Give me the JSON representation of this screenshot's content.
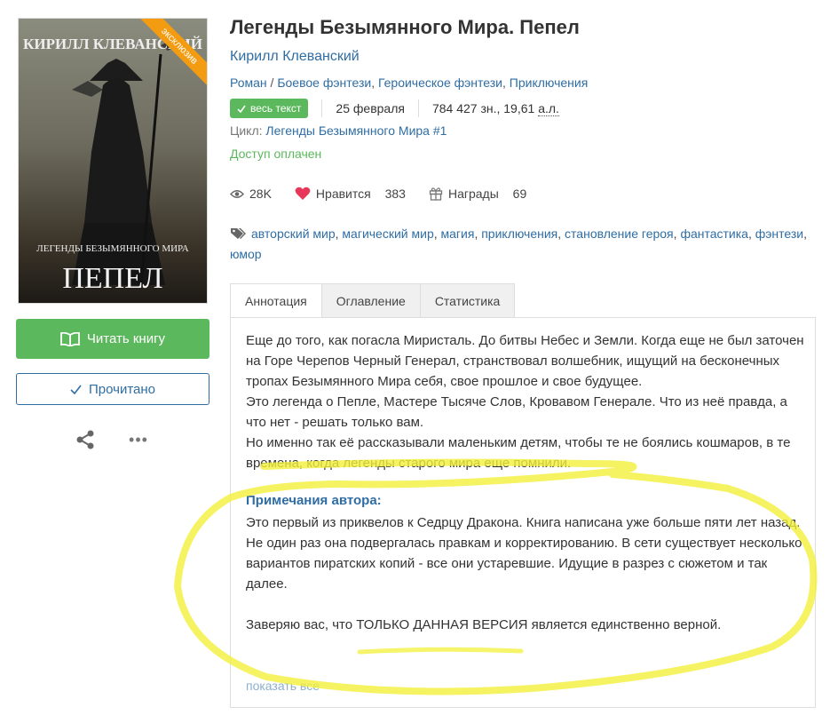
{
  "book": {
    "title": "Легенды Безымянного Мира. Пепел",
    "author": "Кирилл Клеванский",
    "genres": {
      "first": "Роман",
      "separator": " / ",
      "items": [
        "Боевое фэнтези",
        "Героическое фэнтези",
        "Приключения"
      ]
    },
    "badge": "весь текст",
    "date": "25 февраля",
    "size": "784 427 зн., 19,61",
    "size_unit": "а.л.",
    "cycle_label": "Цикл:",
    "cycle": "Легенды Безымянного Мира #1",
    "access": "Доступ оплачен"
  },
  "cover": {
    "author": "КИРИЛЛ КЛЕВАНСКИЙ",
    "series": "ЛЕГЕНДЫ БЕЗЫМЯННОГО МИРА",
    "title": "ПЕПЕЛ",
    "ribbon": "эксклюзив"
  },
  "stats": {
    "views": "28K",
    "likes_label": "Нравится",
    "likes": "383",
    "awards_label": "Награды",
    "awards": "69"
  },
  "tags": [
    "авторский мир",
    "магический мир",
    "магия",
    "приключения",
    "становление героя",
    "фантастика",
    "фэнтези",
    "юмор"
  ],
  "actions": {
    "read": "Читать книгу",
    "done": "Прочитано",
    "more": "•••"
  },
  "tabs": [
    "Аннотация",
    "Оглавление",
    "Статистика"
  ],
  "annotation": [
    "Еще до того, как погасла Миристаль. До битвы Небес и Земли. Когда еще не был заточен на Горе Черепов Черный Генерал, странствовал волшебник, ищущий на бесконечных тропах Безымянного Мира себя, свое прошлое и свое будущее.",
    "Это легенда о Пепле, Мастере Тысяче Слов, Кровавом Генерале. Что из неё правда, а что нет - решать только вам.",
    "Но именно так её рассказывали маленьким детям, чтобы те не боялись кошмаров, в те времена, когда легенды старого мира еще помнили."
  ],
  "notes_title": "Примечания автора:",
  "notes": [
    "Это первый из приквелов к Седрцу Дракона. Книга написана уже больше пяти лет назад.",
    "Не один раз она подвергалась правкам и корректированию. В сети существует несколько вариантов пиратских копий - все они устаревшие. Идущие в разрез с сюжетом и так далее."
  ],
  "final_note": "Заверяю вас, что ТОЛЬКО ДАННАЯ ВЕРСИЯ является единственно верной.",
  "show_all": "показать все",
  "colors": {
    "accent": "#2f6da3",
    "green": "#5cb85c",
    "like": "#e8385a",
    "highlight": "#f3f03a",
    "ribbon": "#f39c12"
  }
}
